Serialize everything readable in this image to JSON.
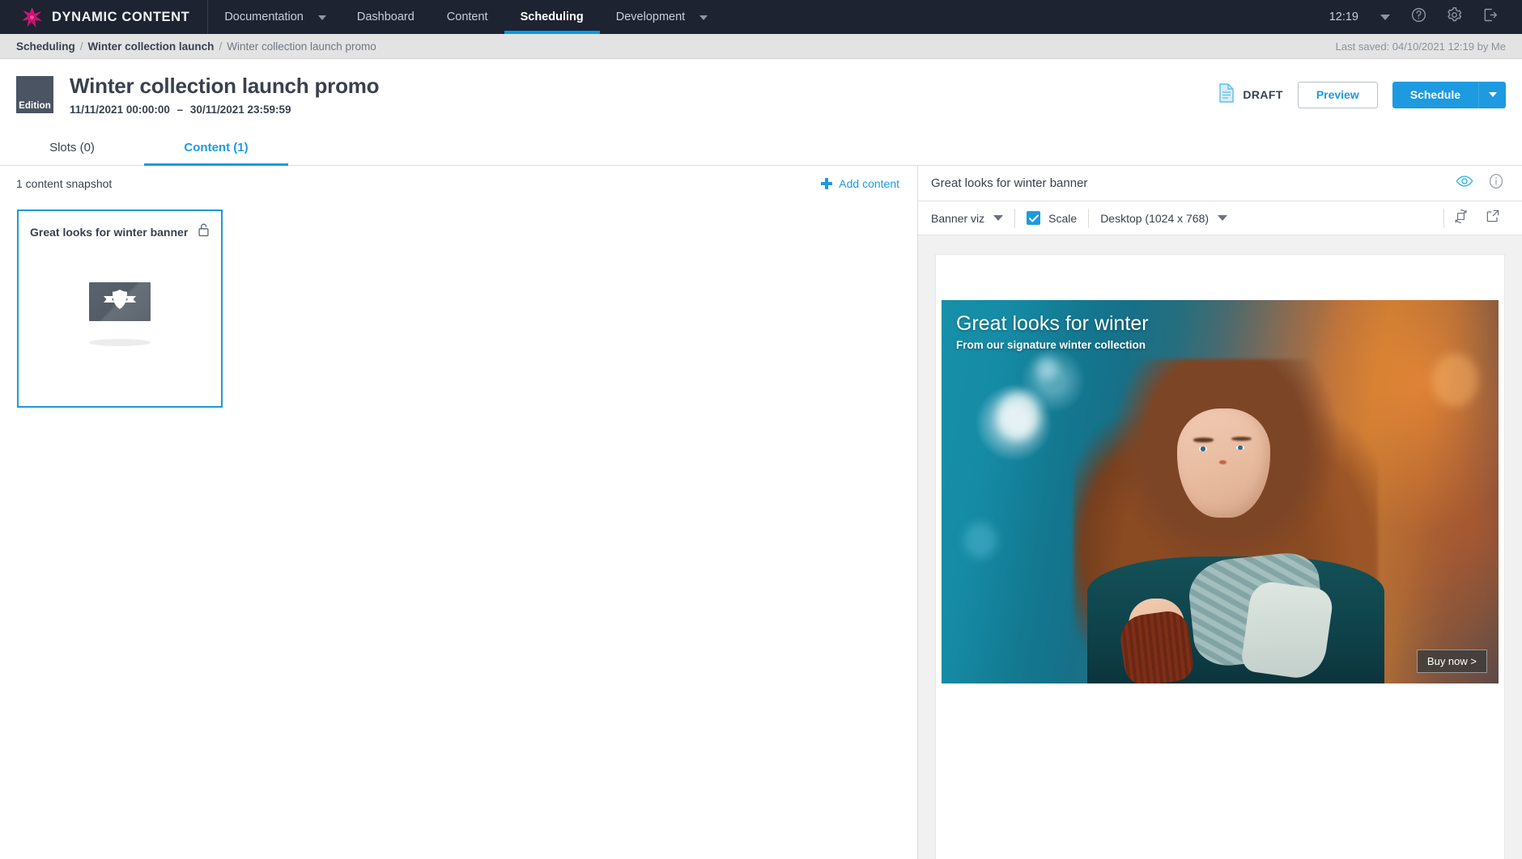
{
  "topnav": {
    "brand": "DYNAMIC CONTENT",
    "items": [
      {
        "label": "Documentation",
        "caret": true,
        "active": false
      },
      {
        "label": "Dashboard",
        "caret": false,
        "active": false
      },
      {
        "label": "Content",
        "caret": false,
        "active": false
      },
      {
        "label": "Scheduling",
        "caret": false,
        "active": true
      },
      {
        "label": "Development",
        "caret": true,
        "active": false
      }
    ],
    "clock": "12:19",
    "icons": [
      "help-icon",
      "gear-icon",
      "logout-icon"
    ]
  },
  "breadcrumb": {
    "items": [
      "Scheduling",
      "Winter collection launch",
      "Winter collection launch promo"
    ],
    "separator": "/",
    "last_saved": "Last saved: 04/10/2021 12:19 by Me"
  },
  "header": {
    "badge": "Edition",
    "title": "Winter collection launch promo",
    "date_start": "11/11/2021 00:00:00",
    "date_dash": "–",
    "date_end": "30/11/2021 23:59:59",
    "status": "DRAFT",
    "preview_label": "Preview",
    "schedule_label": "Schedule"
  },
  "tabs": [
    {
      "label": "Slots (0)",
      "active": false
    },
    {
      "label": "Content (1)",
      "active": true
    }
  ],
  "left_pane": {
    "snapshot_count": "1 content snapshot",
    "add_content": "Add content",
    "card": {
      "title": "Great looks for winter banner",
      "lock_state": "unlocked"
    }
  },
  "right_pane": {
    "title": "Great looks for winter banner",
    "toolbar": {
      "viz_select": "Banner viz",
      "scale_label": "Scale",
      "scale_checked": true,
      "device_select": "Desktop (1024 x 768)"
    },
    "banner": {
      "headline": "Great looks for winter",
      "subhead": "From our signature winter collection",
      "cta": "Buy now >"
    }
  },
  "colors": {
    "accent": "#1e9ae0",
    "nav_bg": "#1d2331",
    "text_dark": "#39414f",
    "breadcrumb_bg": "#e3e3e3",
    "stage_bg": "#f1f1f1",
    "badge_bg": "#4a5463"
  }
}
